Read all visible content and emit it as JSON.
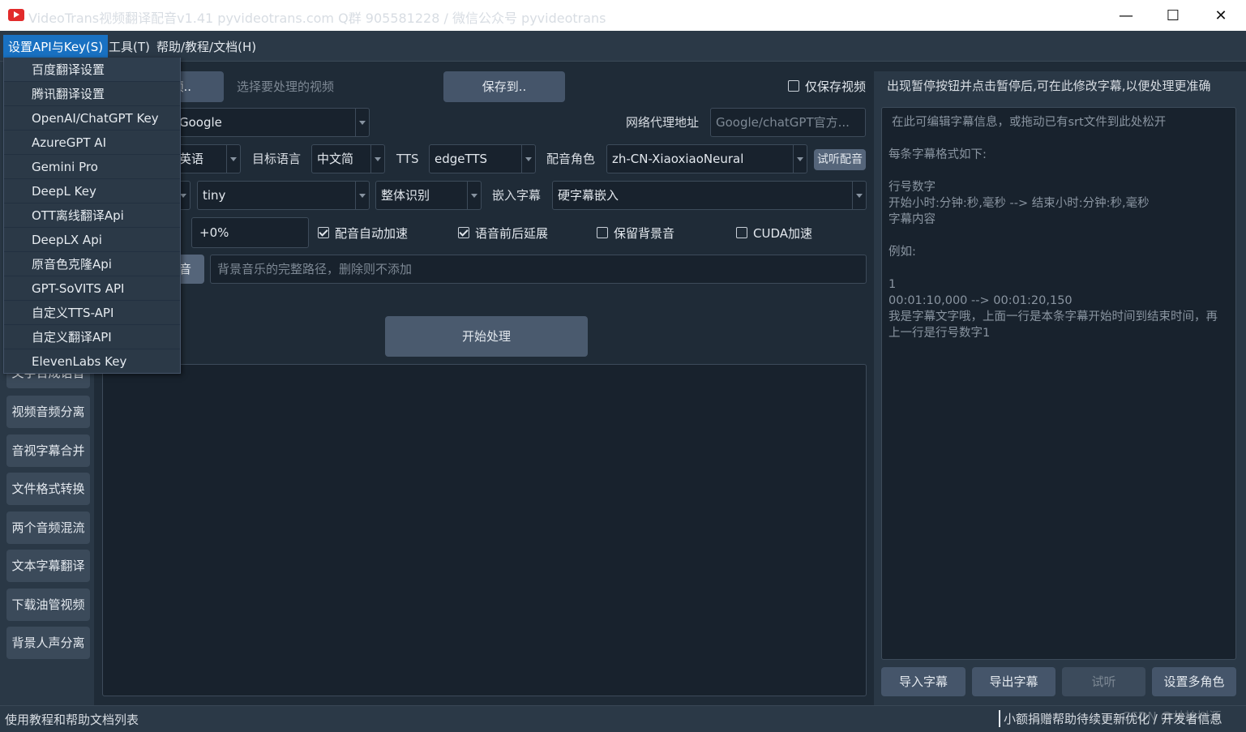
{
  "window": {
    "title": "VideoTrans视频翻译配音v1.41  pyvideotrans.com    Q群 905581228 / 微信公众号 pyvideotrans",
    "minimize": "—",
    "maximize": "☐",
    "close": "✕"
  },
  "menubar": {
    "settings": "设置API与Key(S)",
    "tools": "工具(T)",
    "help": "帮助/教程/文档(H)"
  },
  "dropdown": {
    "items": [
      "百度翻译设置",
      "腾讯翻译设置",
      "OpenAI/ChatGPT Key",
      "AzureGPT AI",
      "Gemini Pro",
      "DeepL Key",
      "OTT离线翻译Api",
      "DeepLX Api",
      "原音色克隆Api",
      "GPT-SoVITS API",
      "自定义TTS-API",
      "自定义翻译API",
      "ElevenLabs Key"
    ]
  },
  "sidebar": {
    "items": [
      "文字合成语音",
      "视频音频分离",
      "音视字幕合并",
      "文件格式转换",
      "两个音频混流",
      "文本字幕翻译",
      "下载油管视频",
      "背景人声分离"
    ]
  },
  "main": {
    "select_video_button": "选择视频..",
    "select_video_hint": "选择要处理的视频",
    "save_to_button": "保存到..",
    "only_save_video": "仅保存视频",
    "translate_engine": "Google",
    "proxy_label": "网络代理地址",
    "proxy_placeholder": "Google/chatGPT官方...",
    "source_language": "英语",
    "target_language_label": "目标语言",
    "target_language": "中文简",
    "tts_label": "TTS",
    "tts_value": "edgeTTS",
    "voice_role_label": "配音角色",
    "voice_role": "zh-CN-XiaoxiaoNeural",
    "preview_voice_button": "试听配音",
    "model_value": "tiny",
    "recognition_mode": "整体识别",
    "embed_subtitle_label": "嵌入字幕",
    "embed_subtitle_value": "硬字幕嵌入",
    "speed_value": "+0%",
    "auto_speedup": "配音自动加速",
    "voice_extend": "语音前后延展",
    "keep_background": "保留背景音",
    "cuda": "CUDA加速",
    "bgm_button": "背景音",
    "bgm_placeholder": "背景音乐的完整路径，删除则不添加",
    "start_button": "开始处理"
  },
  "right": {
    "hint": "出现暂停按钮并点击暂停后,可在此修改字幕,以便处理更准确",
    "editor_lines": [
      "在此可编辑字幕信息，或拖动已有srt文件到此处松开",
      "",
      "每条字幕格式如下:",
      "",
      "行号数字",
      "开始小时:分钟:秒,毫秒 --> 结束小时:分钟:秒,毫秒",
      "字幕内容",
      "",
      "例如:",
      "",
      "1",
      "00:01:10,000 --> 00:01:20,150",
      "我是字幕文字哦，上面一行是本条字幕开始时间到结束时间，再上一行是行号数字1"
    ],
    "import_button": "导入字幕",
    "export_button": "导出字幕",
    "listen_button": "试听",
    "multi_role_button": "设置多角色"
  },
  "status": {
    "left": "使用教程和帮助文档列表",
    "right": "小额捐赠帮助待续更新优化 / 开发者信息",
    "watermark": "CSDN @林柏树源"
  }
}
